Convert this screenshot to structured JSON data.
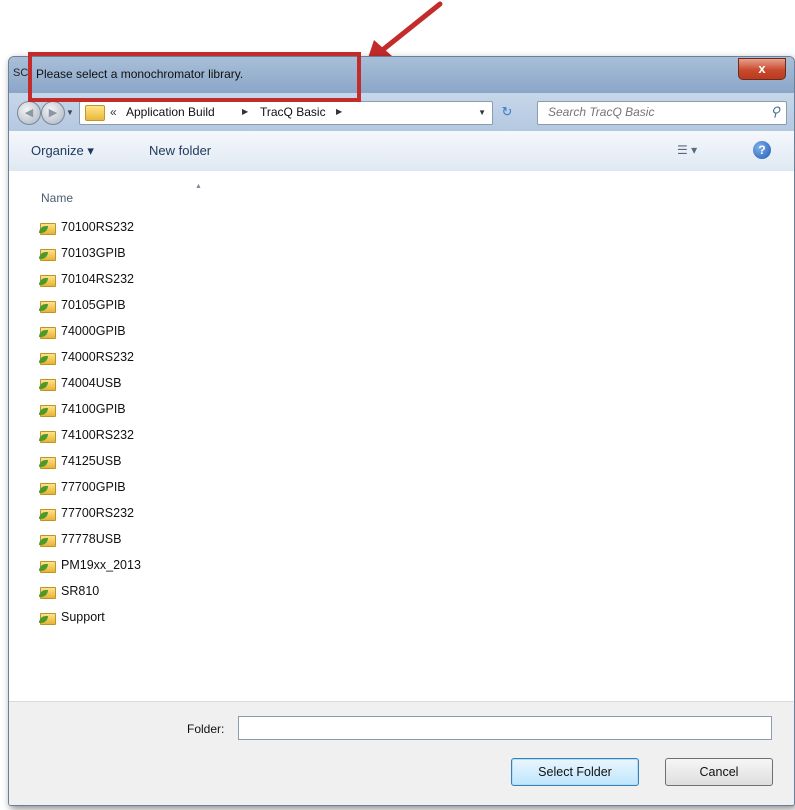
{
  "dialog": {
    "app_icon_text": "SC",
    "title": "Please select a monochromator library.",
    "close_glyph": "x"
  },
  "navigation": {
    "back_glyph": "◀",
    "forward_glyph": "▶",
    "address": {
      "overflow_glyph": "«",
      "crumbs": [
        "Application Build",
        "TracQ Basic"
      ],
      "separator_glyph": "▶",
      "dropdown_glyph": "▼"
    },
    "refresh_glyph": "↻",
    "search_placeholder": "Search TracQ Basic"
  },
  "toolbar": {
    "organize_label": "Organize ▾",
    "new_folder_label": "New folder"
  },
  "filelist": {
    "column_name": "Name",
    "items": [
      "70100RS232",
      "70103GPIB",
      "70104RS232",
      "70105GPIB",
      "74000GPIB",
      "74000RS232",
      "74004USB",
      "74100GPIB",
      "74100RS232",
      "74125USB",
      "77700GPIB",
      "77700RS232",
      "77778USB",
      "PM19xx_2013",
      "SR810",
      "Support"
    ]
  },
  "footer": {
    "folder_label": "Folder:",
    "folder_value": "",
    "select_label": "Select Folder",
    "cancel_label": "Cancel"
  },
  "annotation": {
    "color": "#c42b2b"
  }
}
